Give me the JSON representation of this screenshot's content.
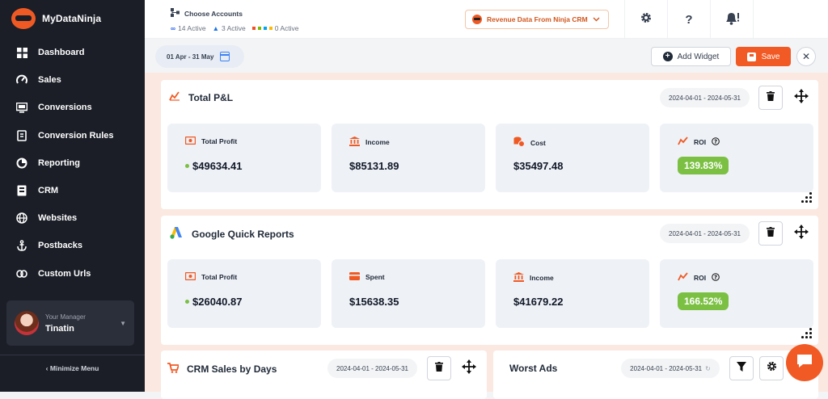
{
  "app": {
    "name": "MyDataNinja"
  },
  "sidebar": {
    "items": [
      {
        "label": "Dashboard",
        "icon": "grid-icon"
      },
      {
        "label": "Sales",
        "icon": "gauge-icon"
      },
      {
        "label": "Conversions",
        "icon": "monitor-icon"
      },
      {
        "label": "Conversion Rules",
        "icon": "rules-icon"
      },
      {
        "label": "Reporting",
        "icon": "pie-icon"
      },
      {
        "label": "CRM",
        "icon": "crm-icon"
      },
      {
        "label": "Websites",
        "icon": "globe-icon"
      },
      {
        "label": "Postbacks",
        "icon": "anchor-icon"
      },
      {
        "label": "Custom Urls",
        "icon": "link-icon"
      }
    ],
    "manager": {
      "role": "Your Manager",
      "name": "Tinatin"
    },
    "minimize_label": "Minimize Menu"
  },
  "topbar": {
    "accounts_title": "Choose Accounts",
    "meta_active": "14 Active",
    "google_active": "3 Active",
    "microsoft_active": "0 Active",
    "source_select": "Revenue Data From Ninja CRM"
  },
  "toolbar": {
    "date_range": "01 Apr - 31 May",
    "add_widget": "Add Widget",
    "save": "Save"
  },
  "widgets": {
    "pl": {
      "title": "Total P&L",
      "range": "2024-04-01 - 2024-05-31",
      "cards": [
        {
          "label": "Total Profit",
          "value": "$49634.41"
        },
        {
          "label": "Income",
          "value": "$85131.89"
        },
        {
          "label": "Cost",
          "value": "$35497.48"
        },
        {
          "label": "ROI",
          "value": "139.83%"
        }
      ]
    },
    "google": {
      "title": "Google Quick Reports",
      "range": "2024-04-01 - 2024-05-31",
      "cards": [
        {
          "label": "Total Profit",
          "value": "$26040.87"
        },
        {
          "label": "Spent",
          "value": "$15638.35"
        },
        {
          "label": "Income",
          "value": "$41679.22"
        },
        {
          "label": "ROI",
          "value": "166.52%"
        }
      ]
    },
    "crm": {
      "title": "CRM Sales by Days",
      "range": "2024-04-01 - 2024-05-31"
    },
    "worst": {
      "title": "Worst Ads",
      "range": "2024-04-01 - 2024-05-31"
    }
  },
  "colors": {
    "accent": "#f15a24",
    "roi_green": "#7bc043",
    "sidebar": "#1b1e27"
  }
}
